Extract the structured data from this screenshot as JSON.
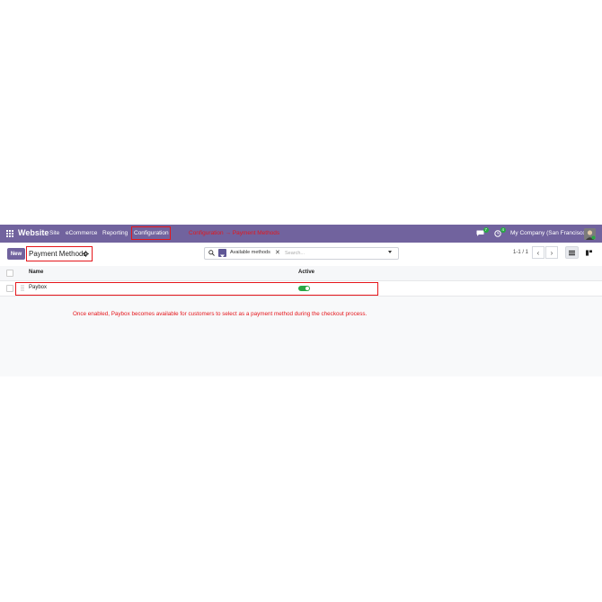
{
  "navbar": {
    "brand": "Website",
    "menu": [
      "Site",
      "eCommerce",
      "Reporting",
      "Configuration"
    ],
    "annotation": "Configuration → Payment Methods",
    "messages_count": "7",
    "activity_count": "4",
    "company": "My Company (San Francisco)"
  },
  "control_panel": {
    "new_label": "New",
    "breadcrumb": "Payment Methods",
    "search": {
      "facet": "Available methods",
      "placeholder": "Search..."
    },
    "pager": "1-1 / 1"
  },
  "list": {
    "columns": [
      "Name",
      "Active"
    ],
    "rows": [
      {
        "name": "Paybox",
        "active": true
      }
    ]
  },
  "note": "Once enabled, Paybox becomes available for customers to select as a payment method during the checkout process.",
  "colors": {
    "brand": "#71639e",
    "annotation": "#e5161b",
    "toggle_on": "#28a745"
  },
  "icons": [
    "apps-icon",
    "gear-icon",
    "search-icon",
    "filter-icon",
    "close-icon",
    "chevron-down-icon",
    "chat-icon",
    "clock-icon",
    "chevron-left-icon",
    "chevron-right-icon",
    "list-view-icon",
    "kanban-view-icon",
    "drag-handle-icon"
  ]
}
